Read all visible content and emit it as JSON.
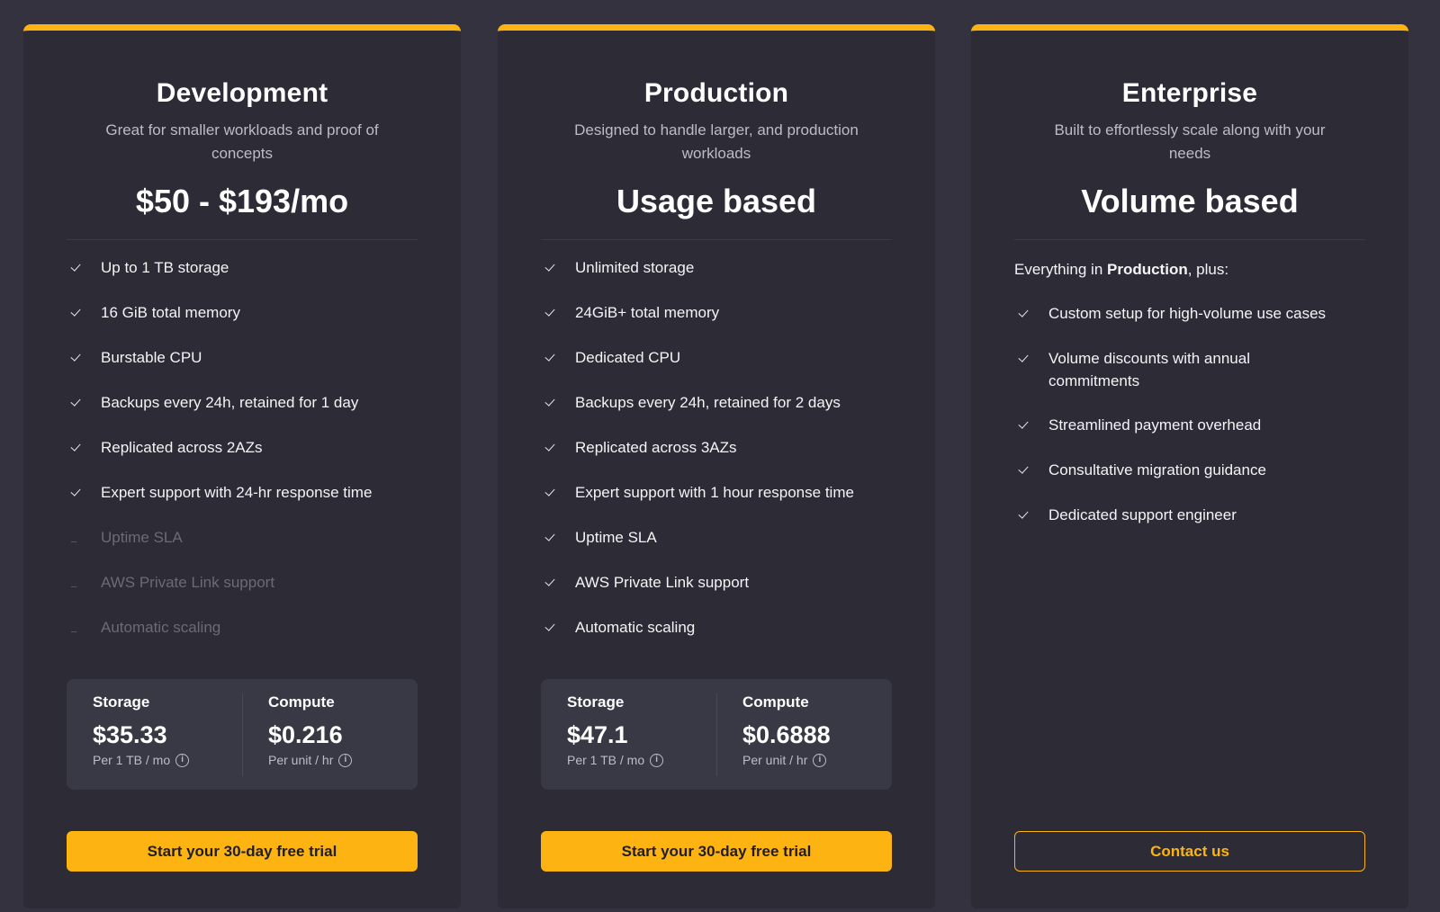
{
  "colors": {
    "accent": "#fdb413",
    "card": "#2c2b36",
    "background": "#34323f"
  },
  "plans": [
    {
      "title": "Development",
      "subtitle": "Great for smaller workloads and proof of concepts",
      "price": "$50 - $193/mo",
      "features": [
        {
          "text": "Up to 1 TB storage",
          "included": true
        },
        {
          "text": "16 GiB total memory",
          "included": true
        },
        {
          "text": "Burstable CPU",
          "included": true
        },
        {
          "text": "Backups every 24h, retained for 1 day",
          "included": true
        },
        {
          "text": "Replicated across 2AZs",
          "included": true
        },
        {
          "text": "Expert support with 24-hr response time",
          "included": true
        },
        {
          "text": "Uptime SLA",
          "included": false
        },
        {
          "text": "AWS Private Link support",
          "included": false
        },
        {
          "text": "Automatic scaling",
          "included": false
        }
      ],
      "storage": {
        "label": "Storage",
        "value": "$35.33",
        "unit": "Per 1 TB / mo",
        "icon": "info-icon"
      },
      "compute": {
        "label": "Compute",
        "value": "$0.216",
        "unit": "Per unit / hr",
        "icon": "info-icon"
      },
      "cta": "Start your 30-day free trial"
    },
    {
      "title": "Production",
      "subtitle": "Designed to handle larger, and production workloads",
      "price": "Usage based",
      "features": [
        {
          "text": "Unlimited storage",
          "included": true
        },
        {
          "text": "24GiB+ total memory",
          "included": true
        },
        {
          "text": "Dedicated CPU",
          "included": true
        },
        {
          "text": "Backups every 24h, retained for 2 days",
          "included": true
        },
        {
          "text": "Replicated across 3AZs",
          "included": true
        },
        {
          "text": "Expert support with 1 hour response time",
          "included": true
        },
        {
          "text": "Uptime SLA",
          "included": true
        },
        {
          "text": "AWS Private Link support",
          "included": true
        },
        {
          "text": "Automatic scaling",
          "included": true
        }
      ],
      "storage": {
        "label": "Storage",
        "value": "$47.1",
        "unit": "Per 1 TB / mo",
        "icon": "info-icon"
      },
      "compute": {
        "label": "Compute",
        "value": "$0.6888",
        "unit": "Per unit / hr",
        "icon": "info-icon"
      },
      "cta": "Start your 30-day free trial"
    },
    {
      "title": "Enterprise",
      "subtitle": "Built to effortlessly scale along with your needs",
      "price": "Volume based",
      "lead_prefix": "Everything in ",
      "lead_bold": "Production",
      "lead_suffix": ", plus:",
      "features": [
        {
          "text": "Custom setup for high-volume use cases",
          "included": true
        },
        {
          "text": "Volume discounts with annual commitments",
          "included": true
        },
        {
          "text": "Streamlined payment overhead",
          "included": true
        },
        {
          "text": "Consultative migration guidance",
          "included": true
        },
        {
          "text": "Dedicated support engineer",
          "included": true
        }
      ],
      "cta": "Contact us"
    }
  ]
}
